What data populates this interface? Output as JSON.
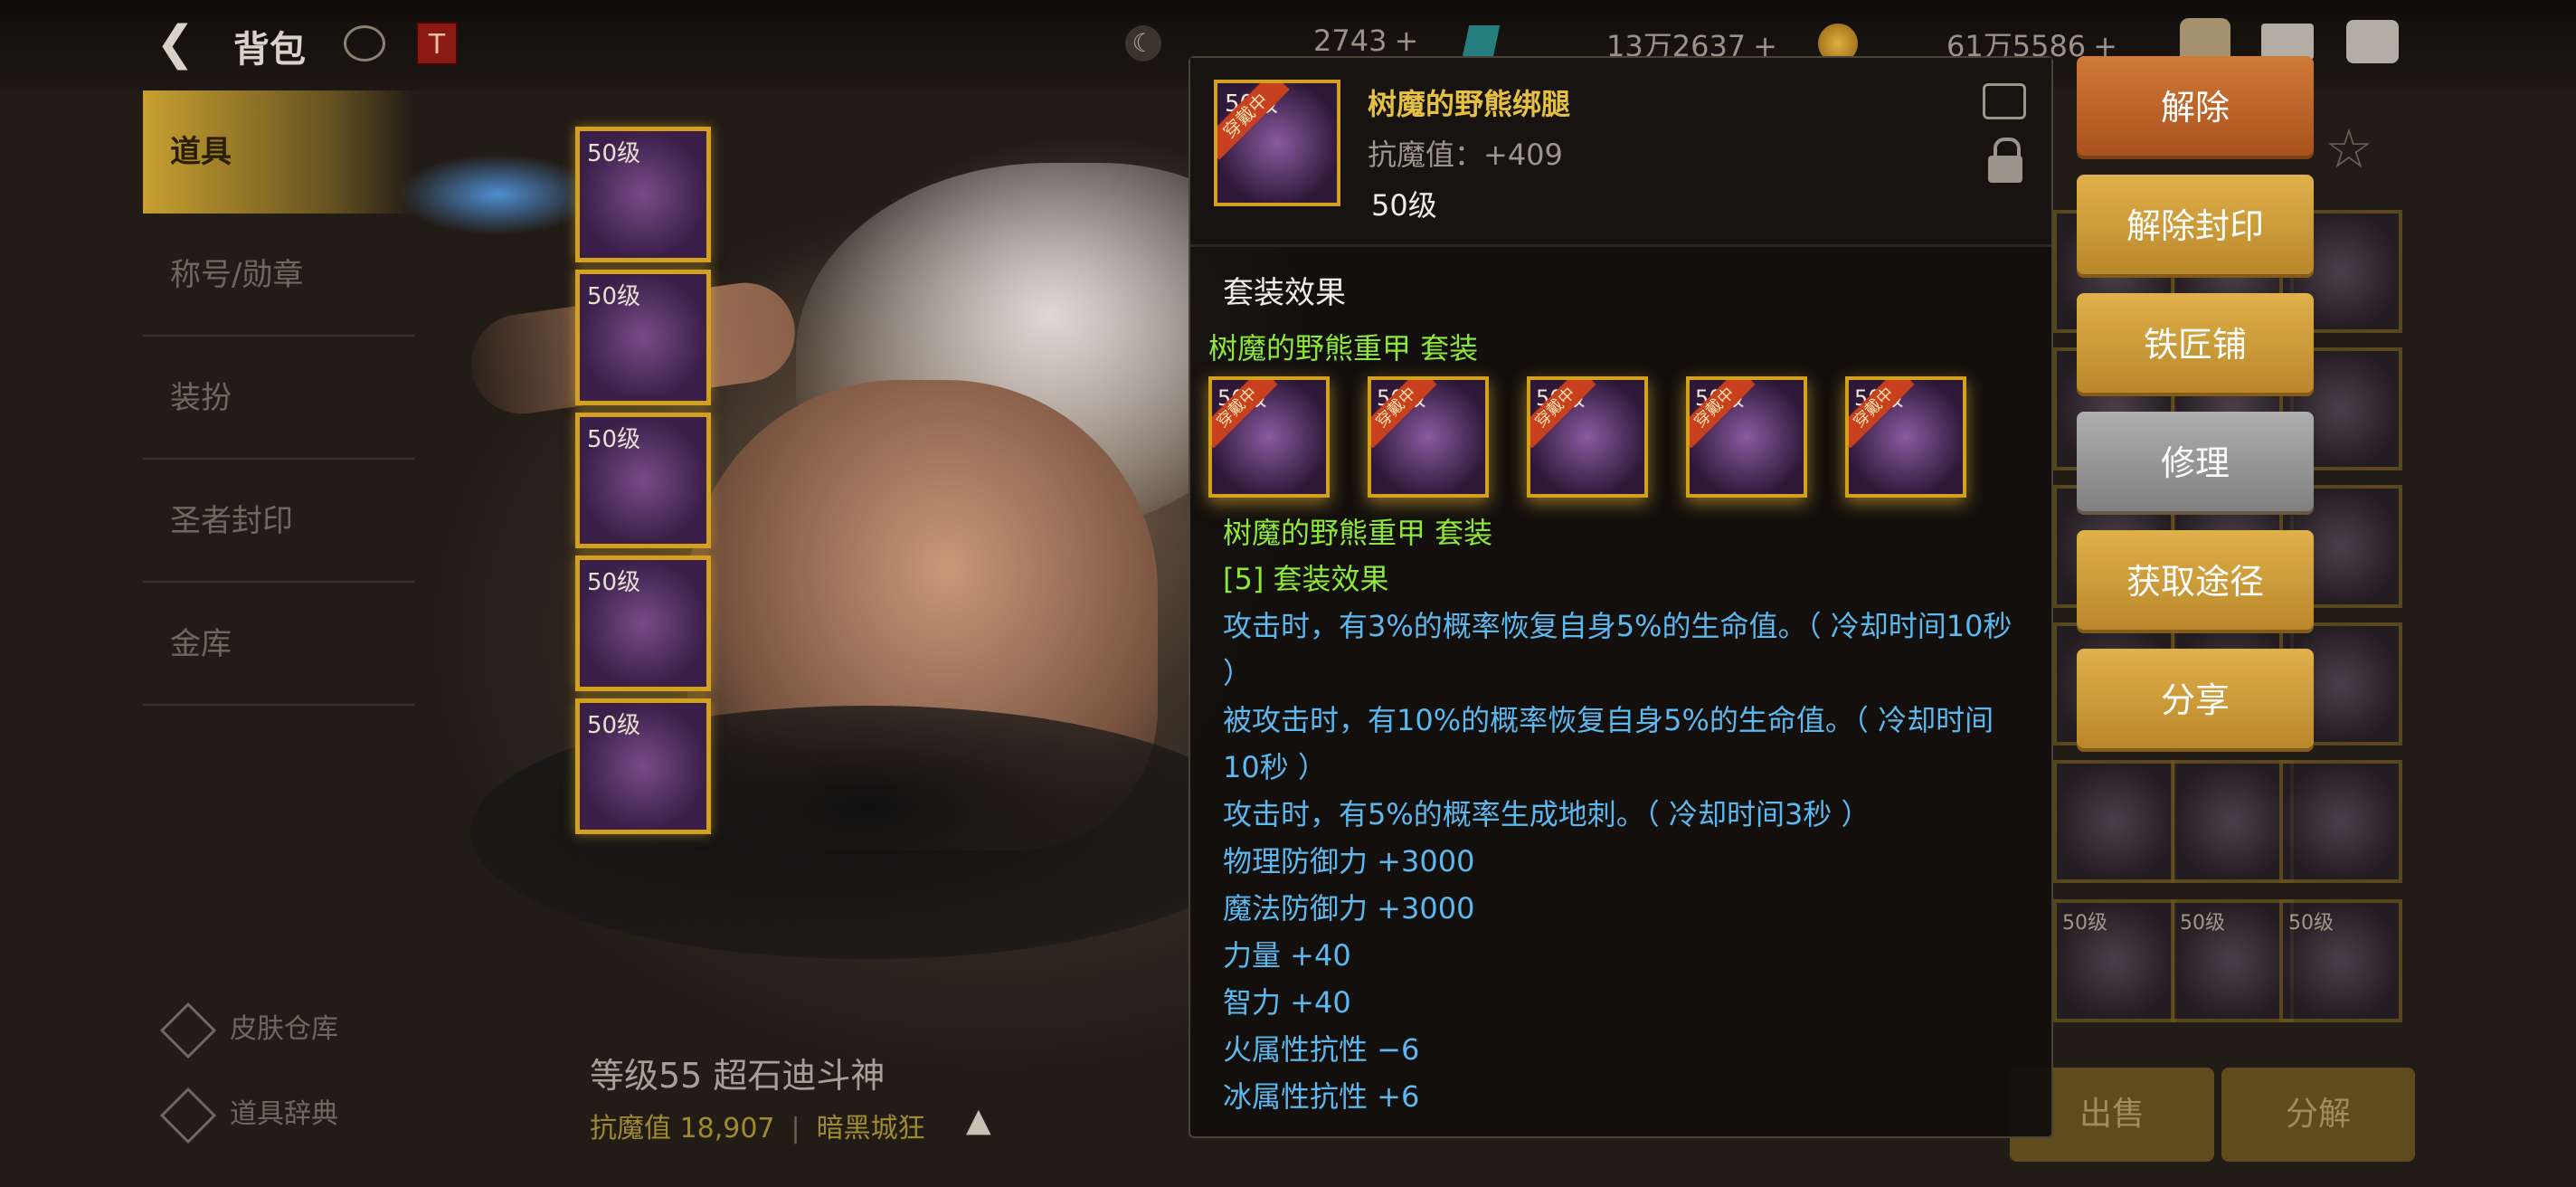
{
  "header": {
    "title": "背包",
    "currencies": [
      {
        "value": "2743"
      },
      {
        "value": "13万2637"
      },
      {
        "value": "61万5586"
      }
    ]
  },
  "nav": {
    "items": [
      "道具",
      "称号/勋章",
      "装扮",
      "圣者封印",
      "金库"
    ],
    "bottom": [
      "皮肤仓库",
      "道具辞典"
    ]
  },
  "equipped": {
    "level_label": "50级",
    "count": 5
  },
  "character": {
    "name": "等级55 超石迪斗神",
    "resist_label": "抗魔值",
    "resist_value": "18,907",
    "extra": "暗黑城狂"
  },
  "grid": {
    "level_label": "50级"
  },
  "bottom_buttons": [
    "出售",
    "分解"
  ],
  "tooltip": {
    "item_name": "树魔的野熊绑腿",
    "resist": "抗魔值：+409",
    "level": "50级",
    "badge": "穿戴中",
    "section_title": "套装效果",
    "set_name": "树魔的野熊重甲  套装",
    "set_level_label": "50级",
    "set_name2": "树魔的野熊重甲  套装",
    "set_effect_title": "[5] 套装效果",
    "lines": [
      "攻击时，有3%的概率恢复自身5%的生命值。（ 冷却时间10秒 ）",
      "被攻击时，有10%的概率恢复自身5%的生命值。（ 冷却时间10秒 ）",
      "攻击时，有5%的概率生成地刺。（ 冷却时间3秒 ）",
      "物理防御力 +3000",
      "魔法防御力 +3000",
      "力量 +40",
      "智力 +40",
      "火属性抗性 −6",
      "冰属性抗性 +6"
    ]
  },
  "actions": [
    "解除",
    "解除封印",
    "铁匠铺",
    "修理",
    "获取途径",
    "分享"
  ]
}
